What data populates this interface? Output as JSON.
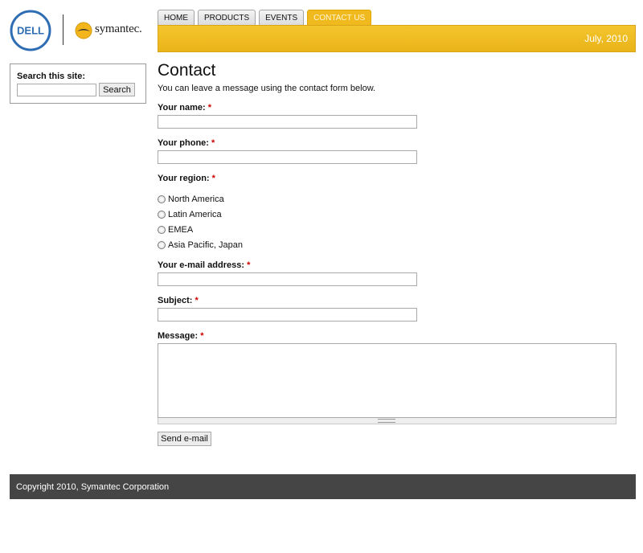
{
  "header": {
    "logo_dell_text": "DELL",
    "logo_symantec_text": "symantec."
  },
  "search": {
    "label": "Search this site:",
    "value": "",
    "button_label": "Search"
  },
  "tabs": [
    {
      "label": "HOME",
      "active": false
    },
    {
      "label": "PRODUCTS",
      "active": false
    },
    {
      "label": "EVENTS",
      "active": false
    },
    {
      "label": "CONTACT US",
      "active": true
    }
  ],
  "banner": {
    "date": "July, 2010"
  },
  "page": {
    "title": "Contact",
    "intro": "You can leave a message using the contact form below."
  },
  "form": {
    "required_marker": "*",
    "name_label": "Your name:",
    "phone_label": "Your phone:",
    "region_label": "Your region:",
    "regions": [
      "North America",
      "Latin America",
      "EMEA",
      "Asia Pacific, Japan"
    ],
    "email_label": "Your e-mail address:",
    "subject_label": "Subject:",
    "message_label": "Message:",
    "submit_label": "Send e-mail"
  },
  "footer": {
    "text": "Copyright 2010, Symantec Corporation"
  },
  "colors": {
    "accent": "#f0b91e",
    "dell_blue": "#2e6db4",
    "footer_bg": "#454545",
    "required": "#cc0000"
  }
}
